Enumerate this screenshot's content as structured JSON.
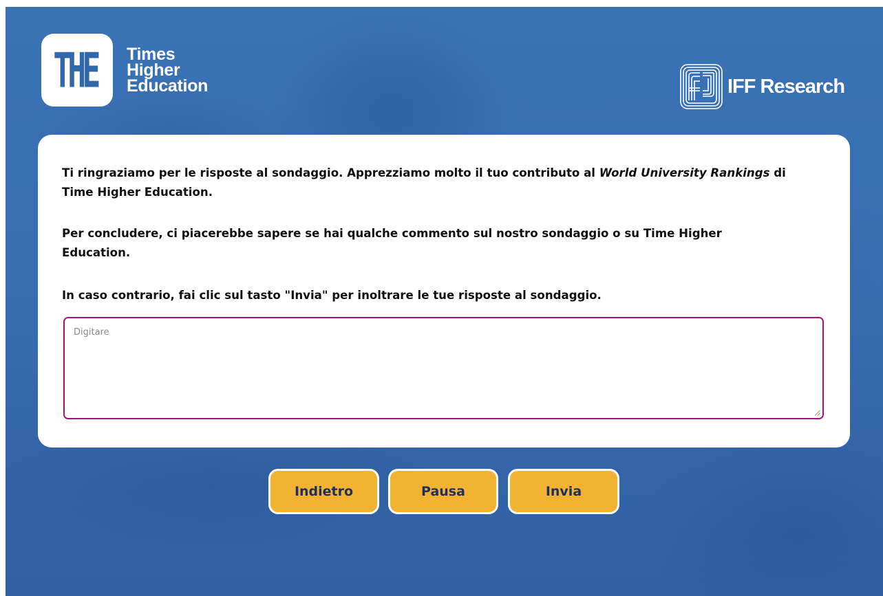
{
  "header": {
    "the_logo": {
      "mark": "THE",
      "words": [
        "Times",
        "Higher",
        "Education"
      ]
    },
    "iff_logo": {
      "text": "IFF Research"
    }
  },
  "survey": {
    "paragraph1": {
      "before": "Ti ringraziamo per le risposte al sondaggio. Apprezziamo molto il tuo contributo al ",
      "italic": "World University Rankings",
      "after": " di Time Higher Education."
    },
    "paragraph2": "Per concludere, ci piacerebbe sapere se hai qualche commento sul nostro sondaggio o su Time Higher Education.",
    "paragraph3": "In caso contrario, fai clic sul tasto \"Invia\" per inoltrare le tue risposte al sondaggio.",
    "comment": {
      "placeholder": "Digitare",
      "value": ""
    }
  },
  "buttons": {
    "back": "Indietro",
    "pause": "Pausa",
    "send": "Invia"
  },
  "colors": {
    "background": "#376eb2",
    "button": "#f2b333",
    "button_text": "#1f2f5e",
    "input_border": "#a1157a"
  }
}
